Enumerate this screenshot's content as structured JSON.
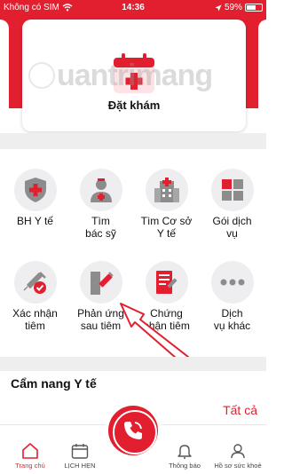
{
  "status_bar": {
    "carrier": "Không có SIM",
    "time": "14:36",
    "battery": "59%"
  },
  "booking_card": {
    "label": "Đặt khám",
    "icon": "calendar-medical-icon"
  },
  "watermark": "uantrimang",
  "services": [
    {
      "label_line1": "BH Y tế",
      "label_line2": "",
      "icon": "shield-cross-icon"
    },
    {
      "label_line1": "Tìm",
      "label_line2": "bác sỹ",
      "icon": "doctor-icon"
    },
    {
      "label_line1": "Tìm Cơ sở",
      "label_line2": "Y tế",
      "icon": "hospital-icon"
    },
    {
      "label_line1": "Gói dịch",
      "label_line2": "vụ",
      "icon": "grid-package-icon"
    },
    {
      "label_line1": "Xác nhận",
      "label_line2": "tiêm",
      "icon": "syringe-check-icon"
    },
    {
      "label_line1": "Phản ứng",
      "label_line2": "sau tiêm",
      "icon": "syringe-reaction-icon"
    },
    {
      "label_line1": "Chứng",
      "label_line2": "nhận tiêm",
      "icon": "vaccine-certificate-icon"
    },
    {
      "label_line1": "Dịch",
      "label_line2": "vụ khác",
      "icon": "more-dots-icon"
    }
  ],
  "section": {
    "title": "Cẩm nang Y tế",
    "link": "Tất cả"
  },
  "bottom_nav": {
    "home": "Trang chủ",
    "schedule": "LỊCH HẸN",
    "notifications": "Thông báo",
    "profile": "Hồ sơ sức khoẻ"
  },
  "colors": {
    "accent": "#e21f2f",
    "icon_bg": "#eeeef0",
    "icon_gray": "#8c8c8c"
  }
}
